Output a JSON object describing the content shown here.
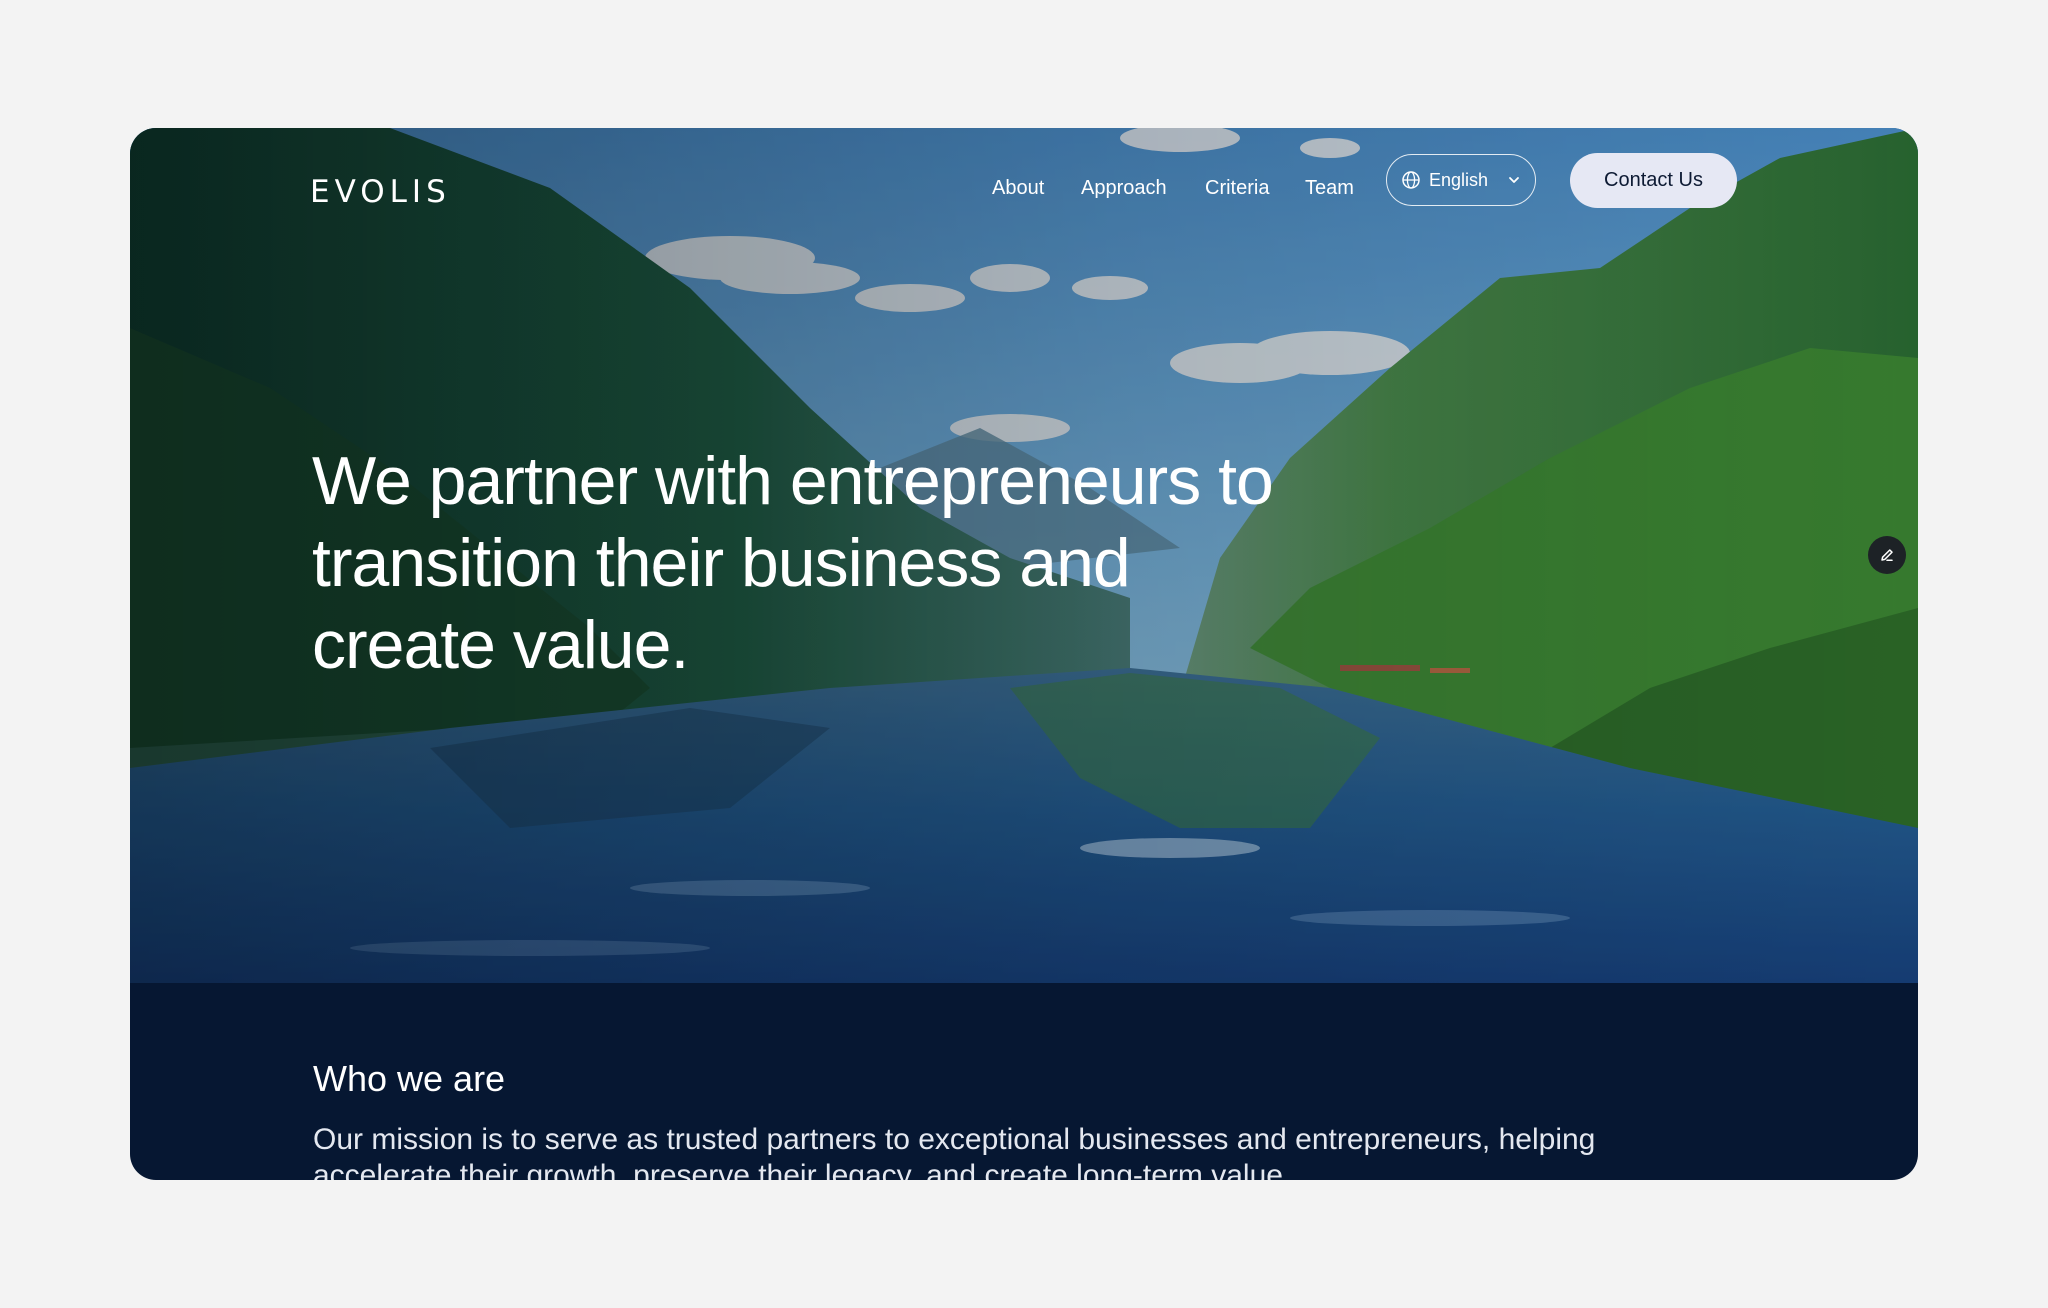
{
  "brand": {
    "logo": "EVOLIS"
  },
  "nav": {
    "links": [
      "About",
      "Approach",
      "Criteria",
      "Team"
    ],
    "language": {
      "selected": "English",
      "icon": "globe-icon",
      "dropdown_icon": "chevron-down-icon"
    },
    "cta": "Contact Us"
  },
  "hero": {
    "headline": "We partner with entrepreneurs to transition their business and create value.",
    "background": "lake-valley-photo",
    "edit_icon": "pencil-icon"
  },
  "who": {
    "title": "Who we are",
    "text": "Our mission is to serve as trusted partners to exceptional businesses and entrepreneurs, helping accelerate their growth, preserve their legacy, and create long-term value."
  },
  "colors": {
    "page_background": "#f3f3f3",
    "navy": "#061732",
    "cta_background": "#e6e8f4",
    "cta_text": "#0d1a33",
    "white": "#ffffff"
  }
}
